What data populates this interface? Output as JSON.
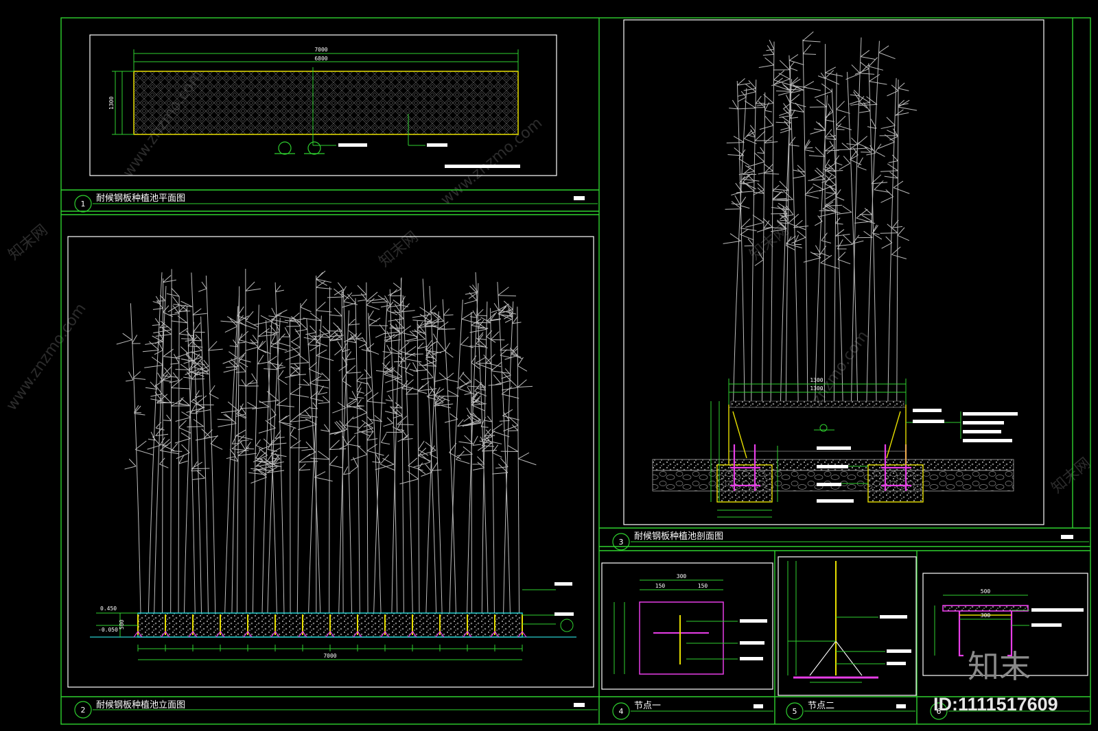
{
  "drawing": {
    "panels": [
      {
        "number": "1",
        "title": "耐候钢板种植池平面图"
      },
      {
        "number": "2",
        "title": "耐候钢板种植池立面图"
      },
      {
        "number": "3",
        "title": "耐候钢板种植池剖面图"
      },
      {
        "number": "4",
        "title": "节点一"
      },
      {
        "number": "5",
        "title": "节点二"
      },
      {
        "number": "6",
        "title": ""
      }
    ],
    "plan_dims": {
      "overall": "7000",
      "inner": "6800",
      "height": "1300"
    },
    "elevation": {
      "overall": "7000",
      "level_top": "0.450",
      "level_bottom": "-0.050",
      "height": "500"
    },
    "section": {
      "width": "1300"
    },
    "node1": {
      "width": "300",
      "half": "150"
    },
    "node3": {
      "width": "500",
      "inner": "300"
    }
  },
  "watermark": {
    "site": "www.znzmo.com",
    "site_cn": "知末网",
    "brand": "知末",
    "id_label": "ID:1111517609"
  }
}
